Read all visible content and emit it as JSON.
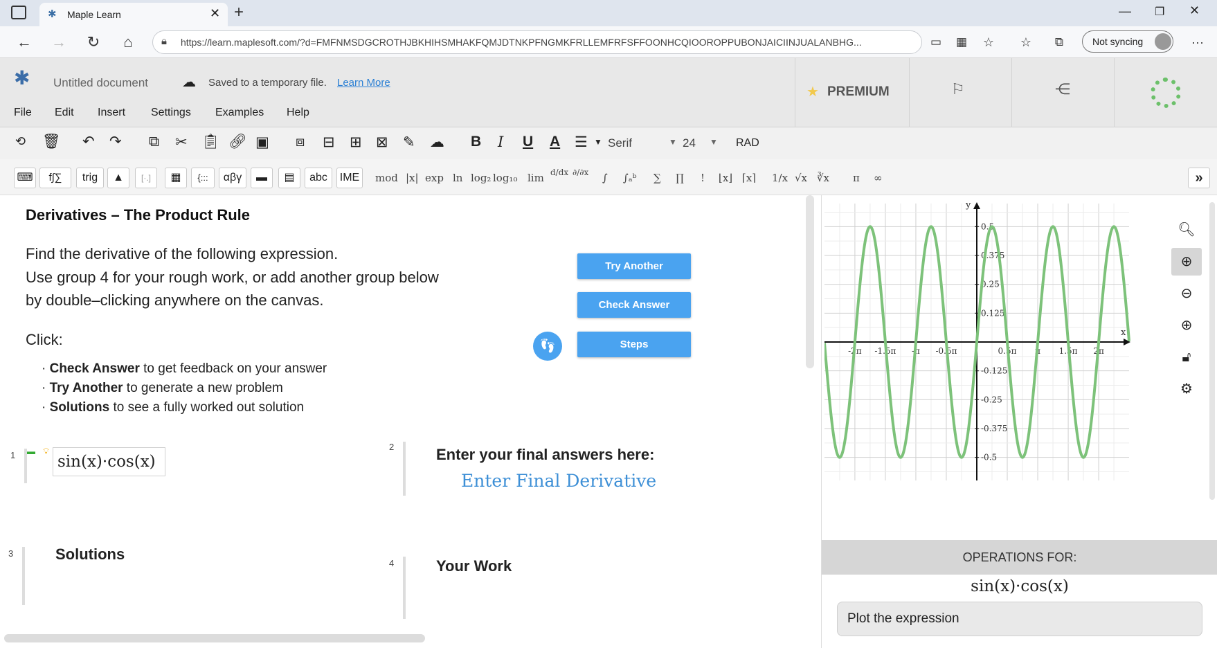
{
  "browser": {
    "tab_title": "Maple Learn",
    "url": "https://learn.maplesoft.com/?d=FMFNMSDGCROTHJBKHIHSMHAKFQMJDTNKPFNGMKFRLLEMFRFSFFOONHCQIOOROPPUBONJAICIINJUALANBHG...",
    "sync_label": "Not syncing",
    "more_label": "···"
  },
  "app": {
    "doc_title": "Untitled document",
    "save_status": "Saved to a temporary file.",
    "learn_more": "Learn More",
    "premium_label": "PREMIUM",
    "menus": [
      "File",
      "Edit",
      "Insert",
      "Settings",
      "Examples",
      "Help"
    ]
  },
  "toolbar": {
    "font_name": "Serif",
    "font_size": "24",
    "angle_mode": "RAD",
    "bold": "B",
    "italic": "I",
    "underline": "U",
    "color": "A"
  },
  "palette": {
    "buttons": [
      "f∫∑",
      "trig",
      "[·.]",
      "{:::",
      "αβγ",
      "abc",
      "IME"
    ],
    "symbols": [
      "mod",
      "|x|",
      "exp",
      "ln",
      "log₂",
      "log₁₀",
      "lim",
      "d/dx",
      "∂/∂x",
      "∫",
      "∫ₐᵇ",
      "∑",
      "∏",
      "!",
      "⌊x⌋",
      "⌈x⌉",
      "1/x",
      "√x",
      "∛x",
      "π",
      "∞"
    ],
    "expand": "»"
  },
  "content": {
    "heading": "Derivatives – The Product Rule",
    "para1": "Find the derivative of the following expression.",
    "para2": "Use group 4 for your rough work, or add another group below",
    "para3": "by double–clicking anywhere on the canvas.",
    "click_label": "Click:",
    "bullets": [
      {
        "bold": "Check Answer",
        "rest": " to get feedback on your answer"
      },
      {
        "bold": "Try Another",
        "rest": " to generate a new problem"
      },
      {
        "bold": "Solutions",
        "rest": " to see a fully worked out solution"
      }
    ],
    "try_another": "Try Another",
    "check_answer": "Check Answer",
    "steps": "Steps"
  },
  "groups": [
    {
      "num": "1",
      "expression": "sin(x)·cos(x)"
    },
    {
      "num": "2",
      "title": "Enter your final answers here:",
      "placeholder": "Enter Final Derivative"
    },
    {
      "num": "3",
      "title": "Solutions"
    },
    {
      "num": "4",
      "title": "Your Work"
    }
  ],
  "operations": {
    "title": "OPERATIONS FOR:",
    "expression": "sin(x)·cos(x)",
    "action": "Plot the expression"
  },
  "plot": {
    "x_label": "x",
    "y_label": "y",
    "x_ticks": [
      "-2π",
      "-1.5π",
      "-π",
      "-0.5π",
      "0.5π",
      "π",
      "1.5π",
      "2π"
    ],
    "y_ticks": [
      "0.5",
      "0.375",
      "0.25",
      "0.125",
      "-0.125",
      "-0.25",
      "-0.375",
      "-0.5"
    ],
    "line_color": "#7dc27a"
  },
  "chart_data": {
    "type": "line",
    "title": "",
    "xlabel": "x",
    "ylabel": "y",
    "function": "sin(x)·cos(x)",
    "xlim": [
      -7.85,
      7.85
    ],
    "ylim": [
      -0.6,
      0.6
    ],
    "series": [
      {
        "values": "y = sin(x)·cos(x)"
      }
    ]
  }
}
